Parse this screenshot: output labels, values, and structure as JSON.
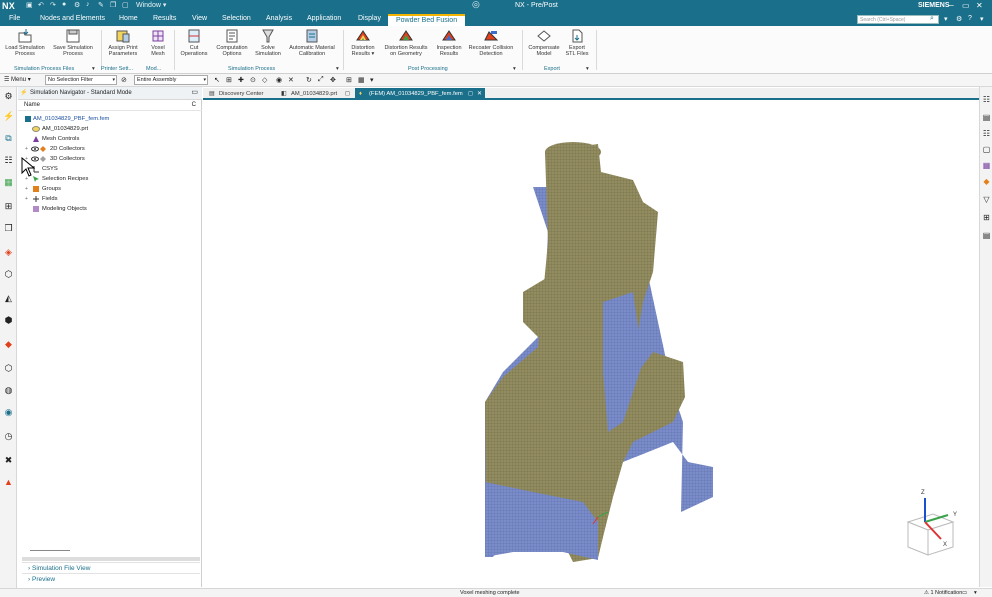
{
  "titlebar": {
    "logo": "NX",
    "window_menu": "Window ▾",
    "title": "NX - Pre/Post",
    "brand": "SIEMENS"
  },
  "menubar": {
    "items": [
      {
        "label": "File"
      },
      {
        "label": "Nodes and Elements"
      },
      {
        "label": "Home"
      },
      {
        "label": "Results"
      },
      {
        "label": "View"
      },
      {
        "label": "Selection"
      },
      {
        "label": "Analysis"
      },
      {
        "label": "Application"
      },
      {
        "label": "Display"
      },
      {
        "label": "Powder Bed Fusion"
      }
    ],
    "search_placeholder": "Search (Ctrl+Space)"
  },
  "ribbon": {
    "buttons": [
      {
        "label1": "Load Simulation",
        "label2": "Process"
      },
      {
        "label1": "Save Simulation",
        "label2": "Process"
      },
      {
        "label1": "Assign Print",
        "label2": "Parameters"
      },
      {
        "label1": "Voxel",
        "label2": "Mesh"
      },
      {
        "label1": "Cut",
        "label2": "Operations"
      },
      {
        "label1": "Computation",
        "label2": "Options"
      },
      {
        "label1": "Solve",
        "label2": "Simulation"
      },
      {
        "label1": "Automatic Material",
        "label2": "Calibration"
      },
      {
        "label1": "Distortion",
        "label2": "Results ▾"
      },
      {
        "label1": "Distortion Results",
        "label2": "on Geometry"
      },
      {
        "label1": "Inspection",
        "label2": "Results"
      },
      {
        "label1": "Recoater Collision",
        "label2": "Detection"
      },
      {
        "label1": "Compensate",
        "label2": "Model"
      },
      {
        "label1": "Export",
        "label2": "STL Files"
      }
    ],
    "groups": [
      {
        "label": "Simulation Process Files"
      },
      {
        "label": "Printer Sett..."
      },
      {
        "label": "Mod..."
      },
      {
        "label": "Simulation Process"
      },
      {
        "label": "Post Processing"
      },
      {
        "label": "Export"
      }
    ]
  },
  "selection_toolbar": {
    "menu": "Menu ▾",
    "filter": "No Selection Filter",
    "scope": "Entire Assembly"
  },
  "navigator": {
    "title": "Simulation Navigator - Standard Mode",
    "col_name": "Name",
    "col_c": "C",
    "tree": [
      {
        "label": "AM_01034829_PBF_fem.fem",
        "level": 0,
        "icon": "fem-file-icon"
      },
      {
        "label": "AM_01034829.prt",
        "level": 1,
        "icon": "part-icon"
      },
      {
        "label": "Mesh Controls",
        "level": 1,
        "icon": "mesh-controls-icon"
      },
      {
        "label": "2D Collectors",
        "level": 1,
        "icon": "collector-2d-icon"
      },
      {
        "label": "3D Collectors",
        "level": 1,
        "icon": "collector-3d-icon"
      },
      {
        "label": "CSYS",
        "level": 1,
        "icon": "csys-icon"
      },
      {
        "label": "Selection Recipes",
        "level": 1,
        "icon": "selection-recipe-icon"
      },
      {
        "label": "Groups",
        "level": 1,
        "icon": "groups-icon"
      },
      {
        "label": "Fields",
        "level": 1,
        "icon": "fields-icon"
      },
      {
        "label": "Modeling Objects",
        "level": 1,
        "icon": "modeling-objects-icon"
      }
    ],
    "bottom_panels": [
      {
        "label": "Simulation File View"
      },
      {
        "label": "Preview"
      }
    ]
  },
  "doc_tabs": [
    {
      "label": "Discovery Center"
    },
    {
      "label": "AM_01034829.prt"
    },
    {
      "label": "(FEM) AM_01034829_PBF_fem.fem"
    }
  ],
  "triad": {
    "z": "Z",
    "y": "Y",
    "x": "X"
  },
  "status": {
    "message": "Voxel meshing complete",
    "notification": "1 Notification"
  },
  "colors": {
    "accent": "#1a6f8a",
    "highlight": "#f2b400",
    "voxel_top": "#8f8a5e",
    "voxel_side": "#7384c4"
  }
}
